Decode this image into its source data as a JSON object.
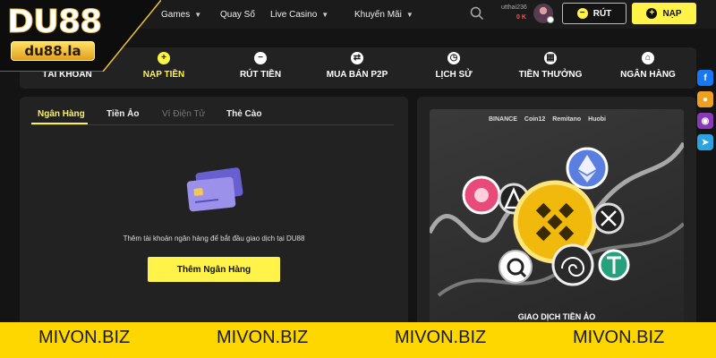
{
  "header": {
    "nav": [
      {
        "label": "Games"
      },
      {
        "label": "Quay Số"
      },
      {
        "label": "Live Casino"
      },
      {
        "label": "Khuyến Mãi"
      }
    ],
    "user": {
      "name": "utthai236",
      "balance": "0 K"
    },
    "withdraw_label": "RÚT",
    "deposit_label": "NẠP"
  },
  "logo": {
    "main": "DU88",
    "sub": "du88.la"
  },
  "account_nav": [
    {
      "label": "TÀI KHOẢN",
      "icon": "user-icon"
    },
    {
      "label": "NẠP TIỀN",
      "icon": "plus-circle-icon",
      "active": true
    },
    {
      "label": "RÚT TIỀN",
      "icon": "minus-circle-icon"
    },
    {
      "label": "MUA BÁN P2P",
      "icon": "swap-icon"
    },
    {
      "label": "LỊCH SỬ",
      "icon": "clock-icon"
    },
    {
      "label": "TIỀN THƯỞNG",
      "icon": "gift-icon"
    },
    {
      "label": "NGÂN HÀNG",
      "icon": "bank-icon"
    }
  ],
  "tabs": [
    {
      "label": "Ngân Hàng",
      "state": "active"
    },
    {
      "label": "Tiền Ảo",
      "state": "normal"
    },
    {
      "label": "Ví Điện Tử",
      "state": "disabled"
    },
    {
      "label": "Thẻ Cào",
      "state": "normal"
    }
  ],
  "empty_state": {
    "text": "Thêm tài khoản ngân hàng để bắt đầu giao dịch tại DU88",
    "button": "Thêm Ngân Hàng"
  },
  "promo": {
    "brands": [
      "BINANCE",
      "Coin12",
      "Remitano",
      "Huobi"
    ],
    "caption": "GIAO DỊCH TIỀN ẢO"
  },
  "social": [
    {
      "icon": "facebook-icon",
      "glyph": "f",
      "color": "#1877f2"
    },
    {
      "icon": "user-group-icon",
      "glyph": "●",
      "color": "#f0a020"
    },
    {
      "icon": "messenger-icon",
      "glyph": "◉",
      "color": "#8a3ab9"
    },
    {
      "icon": "telegram-icon",
      "glyph": "➤",
      "color": "#2aa3e0"
    }
  ],
  "watermark": [
    "MIVON.BIZ",
    "MIVON.BIZ",
    "MIVON.BIZ",
    "MIVON.BIZ"
  ],
  "colors": {
    "accent": "#fff34a",
    "panel": "#222222",
    "background": "#141414",
    "watermark_bar": "#ffd700",
    "balance": "#f05a5a"
  }
}
